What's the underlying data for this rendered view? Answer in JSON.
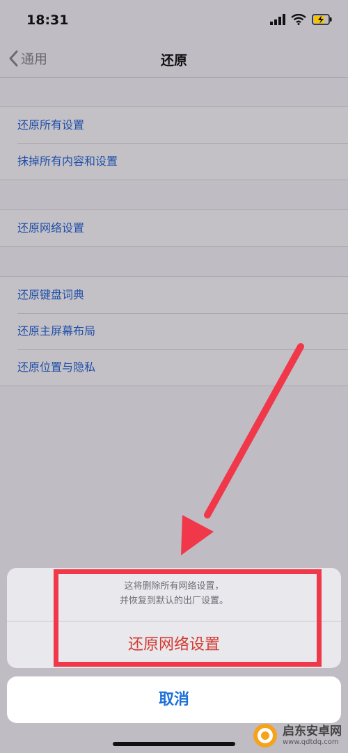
{
  "status_bar": {
    "time": "18:31"
  },
  "nav": {
    "back_label": "通用",
    "title": "还原"
  },
  "groups": [
    {
      "items": [
        "还原所有设置",
        "抹掉所有内容和设置"
      ]
    },
    {
      "items": [
        "还原网络设置"
      ]
    },
    {
      "items": [
        "还原键盘词典",
        "还原主屏幕布局",
        "还原位置与隐私"
      ]
    }
  ],
  "action_sheet": {
    "message_line1": "这将删除所有网络设置，",
    "message_line2": "并恢复到默认的出厂设置。",
    "destructive_label": "还原网络设置",
    "cancel_label": "取消"
  },
  "watermark": {
    "name": "启东安卓网",
    "url": "www.qdtdq.com"
  },
  "colors": {
    "link_blue": "#1f4fa8",
    "destructive_red": "#d23a30",
    "cancel_blue": "#1b6fd8",
    "annotation_red": "#f0384a"
  }
}
